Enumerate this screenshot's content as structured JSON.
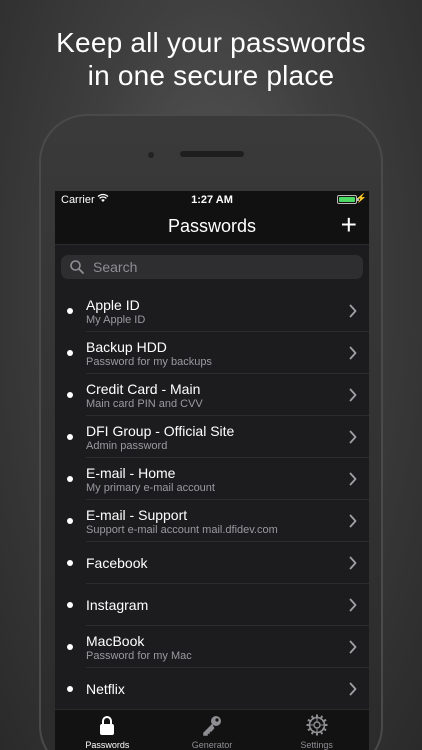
{
  "headline": {
    "line1": "Keep all your passwords",
    "line2": "in one secure place"
  },
  "status_bar": {
    "carrier": "Carrier",
    "time": "1:27 AM",
    "battery_level": 1.0
  },
  "nav": {
    "title": "Passwords",
    "add_label": "+"
  },
  "search": {
    "placeholder": "Search",
    "value": ""
  },
  "entries": [
    {
      "title": "Apple ID",
      "subtitle": "My Apple ID"
    },
    {
      "title": "Backup HDD",
      "subtitle": "Password for my backups"
    },
    {
      "title": "Credit Card - Main",
      "subtitle": "Main card PIN and CVV"
    },
    {
      "title": "DFI Group - Official Site",
      "subtitle": "Admin password"
    },
    {
      "title": "E-mail - Home",
      "subtitle": "My primary e-mail account"
    },
    {
      "title": "E-mail - Support",
      "subtitle": "Support e-mail account mail.dfidev.com"
    },
    {
      "title": "Facebook",
      "subtitle": ""
    },
    {
      "title": "Instagram",
      "subtitle": ""
    },
    {
      "title": "MacBook",
      "subtitle": "Password for my Mac"
    },
    {
      "title": "Netflix",
      "subtitle": ""
    }
  ],
  "tabs": [
    {
      "label": "Passwords",
      "icon": "lock-icon",
      "active": true
    },
    {
      "label": "Generator",
      "icon": "key-icon",
      "active": false
    },
    {
      "label": "Settings",
      "icon": "gear-icon",
      "active": false
    }
  ],
  "colors": {
    "background": "#3f3f3f",
    "screen": "#1c1c1e",
    "battery": "#4cd964"
  }
}
